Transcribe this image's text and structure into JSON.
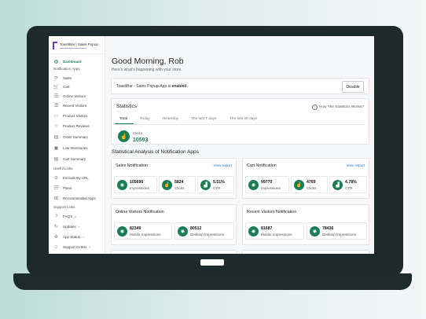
{
  "sidebar": {
    "logo": "ToastiBar | Sales Popup",
    "items_top": [
      {
        "label": "Dashboard",
        "icon": "dashboard-icon",
        "glyph": "◎"
      }
    ],
    "notification_apps_header": "Notification Apps",
    "notification_apps": [
      {
        "label": "Sales",
        "icon": "sales-icon",
        "glyph": "⟳"
      },
      {
        "label": "Cart",
        "icon": "cart-icon",
        "glyph": "🛒"
      },
      {
        "label": "Online Visitors",
        "icon": "online-visitors-icon",
        "glyph": "☰"
      },
      {
        "label": "Recent Visitors",
        "icon": "recent-visitors-icon",
        "glyph": "☰"
      },
      {
        "label": "Product Visitors",
        "icon": "product-visitors-icon",
        "glyph": "▭"
      },
      {
        "label": "Product Reviews",
        "icon": "star-icon",
        "glyph": "☆"
      },
      {
        "label": "Order Summary",
        "icon": "order-summary-icon",
        "glyph": "▤"
      },
      {
        "label": "Low Inventories",
        "icon": "box-icon",
        "glyph": "▣"
      },
      {
        "label": "Cart Summary",
        "icon": "cart-summary-icon",
        "glyph": "▤"
      }
    ],
    "useful_links_header": "Useful Links",
    "useful_links": [
      {
        "label": "Exclude By URL",
        "icon": "link-icon",
        "glyph": "⊘"
      },
      {
        "label": "Plans",
        "icon": "plans-icon",
        "glyph": "☷"
      },
      {
        "label": "Recommended Apps",
        "icon": "apps-icon",
        "glyph": "⊞"
      }
    ],
    "support_links_header": "Support Links",
    "support_links": [
      {
        "label": "FAQ's",
        "icon": "faq-icon",
        "glyph": "?"
      },
      {
        "label": "Updates",
        "icon": "updates-icon",
        "glyph": "↻"
      },
      {
        "label": "App Status",
        "icon": "status-icon",
        "glyph": "✲"
      },
      {
        "label": "Support Center",
        "icon": "support-icon",
        "glyph": "☺"
      }
    ]
  },
  "header": {
    "greeting": "Good Morning, Rob",
    "subtitle": "Here's what's happening with your store."
  },
  "banner": {
    "text_prefix": "ToastiBar - Sales Popup-App is ",
    "status": "enabled",
    "text_suffix": ".",
    "button": "Disable"
  },
  "statistics": {
    "title": "Statistics",
    "how_link": "How The Statistics Works?",
    "tabs": [
      "Total",
      "Today",
      "Yesterday",
      "The last 7 days",
      "The last 30 days"
    ],
    "active_tab": "Total",
    "clicks_label": "Clicks",
    "clicks_value": "10593"
  },
  "analysis": {
    "title": "Statistical Analysis of Notification Apps",
    "cards": [
      {
        "title": "Sales Notification",
        "link": "View report",
        "metrics": [
          {
            "value": "105690",
            "label": "Impressions",
            "icon": "eye-icon",
            "glyph": "◉"
          },
          {
            "value": "5824",
            "label": "Clicks",
            "icon": "click-icon",
            "glyph": "☝"
          },
          {
            "value": "5.51%",
            "label": "CTR",
            "icon": "chart-icon",
            "glyph": "▟"
          }
        ]
      },
      {
        "title": "Cart Notification",
        "link": "View report",
        "metrics": [
          {
            "value": "99770",
            "label": "Impressions",
            "icon": "eye-icon",
            "glyph": "◉"
          },
          {
            "value": "4769",
            "label": "Clicks",
            "icon": "click-icon",
            "glyph": "☝"
          },
          {
            "value": "4.78%",
            "label": "CTR",
            "icon": "chart-icon",
            "glyph": "▟"
          }
        ]
      },
      {
        "title": "Online Visitors Notification",
        "link": "",
        "metrics": [
          {
            "value": "82349",
            "label": "Mobile Impressions",
            "icon": "eye-icon",
            "glyph": "◉"
          },
          {
            "value": "80512",
            "label": "Desktop Impressions",
            "icon": "eye-icon",
            "glyph": "◉"
          }
        ]
      },
      {
        "title": "Recent Visitors Notification",
        "link": "",
        "metrics": [
          {
            "value": "81687",
            "label": "Mobile Impressions",
            "icon": "eye-icon",
            "glyph": "◉"
          },
          {
            "value": "78436",
            "label": "Desktop Impressions",
            "icon": "eye-icon",
            "glyph": "◉"
          }
        ]
      }
    ]
  },
  "colors": {
    "accent": "#1a7e54",
    "link": "#2d6fd6",
    "bezel": "#1d2a2c"
  }
}
